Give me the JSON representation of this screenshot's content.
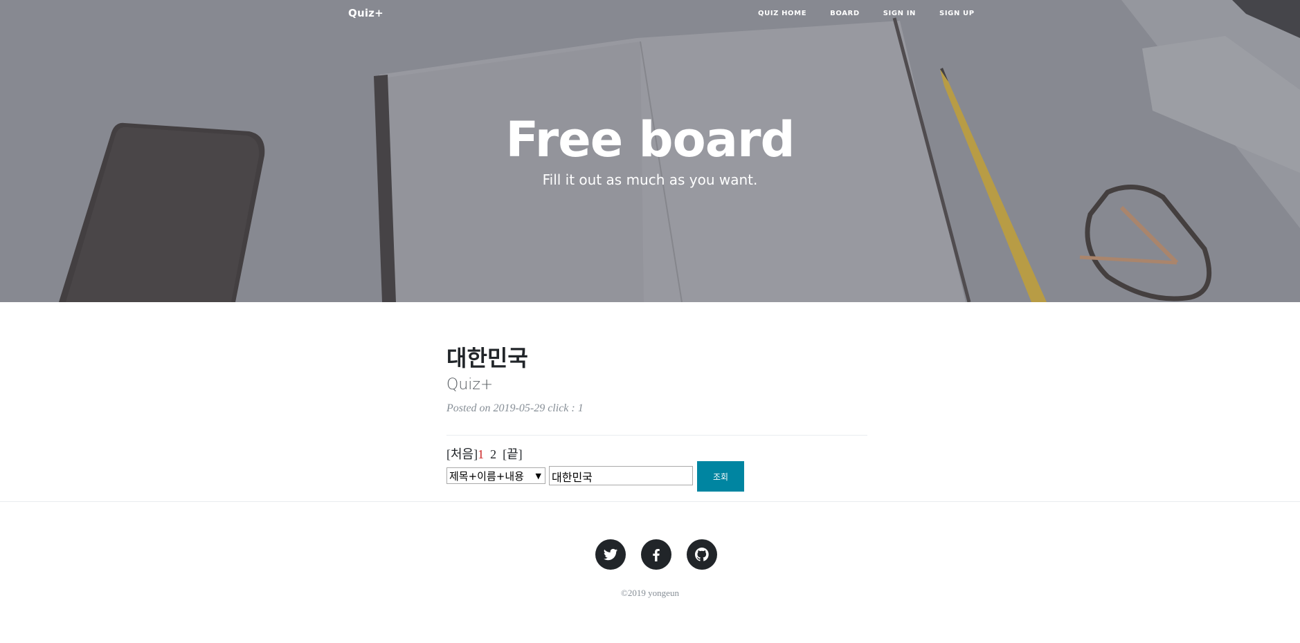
{
  "nav": {
    "brand": "Quiz+",
    "links": [
      "QUIZ HOME",
      "BOARD",
      "SIGN IN",
      "SIGN UP"
    ]
  },
  "hero": {
    "title": "Free board",
    "subtitle": "Fill it out as much as you want."
  },
  "post": {
    "title": "대한민국",
    "subtitle": "Quiz+",
    "meta_prefix": "Posted on",
    "date": "2019-05-29",
    "click_label": "click : 1"
  },
  "pager": {
    "first": "[처음]",
    "current": "1",
    "next": "2",
    "last": "[끝]"
  },
  "search": {
    "field_option": "제목+이름+내용",
    "query": "대한민국",
    "button_label": "조회"
  },
  "footer": {
    "social_icons": [
      "twitter-icon",
      "facebook-icon",
      "github-icon"
    ],
    "copyright": "©2019 yongeun"
  },
  "colors": {
    "accent": "#0085a1",
    "current_page": "#cc2222",
    "dark": "#212529",
    "muted": "#868e96"
  }
}
